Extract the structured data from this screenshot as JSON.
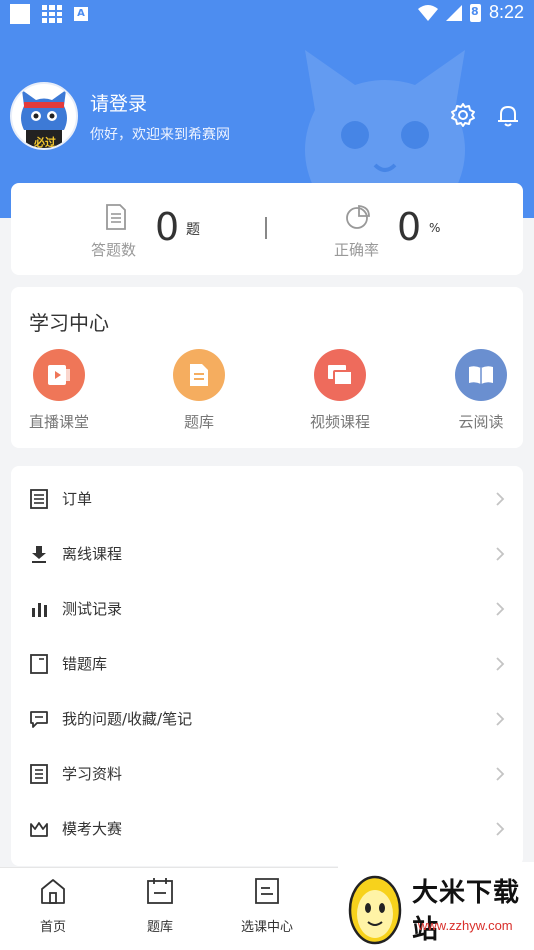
{
  "status_bar": {
    "time": "8:22",
    "battery_text": "8"
  },
  "profile": {
    "avatar_badge": "必过",
    "avatar_band": "必过",
    "login_text": "请登录",
    "welcome_text": "你好，欢迎来到希赛网"
  },
  "stats": {
    "answered": {
      "value": "0",
      "unit": "题",
      "label": "答题数"
    },
    "accuracy": {
      "value": "0",
      "unit": "%",
      "label": "正确率"
    }
  },
  "study_center": {
    "title": "学习中心",
    "items": [
      {
        "label": "直播课堂",
        "color": "#ef7658"
      },
      {
        "label": "题库",
        "color": "#f5ad5f"
      },
      {
        "label": "视频课程",
        "color": "#ee6b5c"
      },
      {
        "label": "云阅读",
        "color": "#6a8fd0"
      }
    ]
  },
  "menu": {
    "items": [
      {
        "label": "订单"
      },
      {
        "label": "离线课程"
      },
      {
        "label": "测试记录"
      },
      {
        "label": "错题库"
      },
      {
        "label": "我的问题/收藏/笔记"
      },
      {
        "label": "学习资料"
      },
      {
        "label": "模考大赛"
      }
    ]
  },
  "tabs": [
    {
      "label": "首页"
    },
    {
      "label": "题库"
    },
    {
      "label": "选课中心"
    }
  ],
  "watermark": {
    "title": "大米下载站",
    "url": "www.zzhyw.com"
  },
  "colors": {
    "header_blue": "#4d8df0",
    "background": "#f3f4f6"
  }
}
